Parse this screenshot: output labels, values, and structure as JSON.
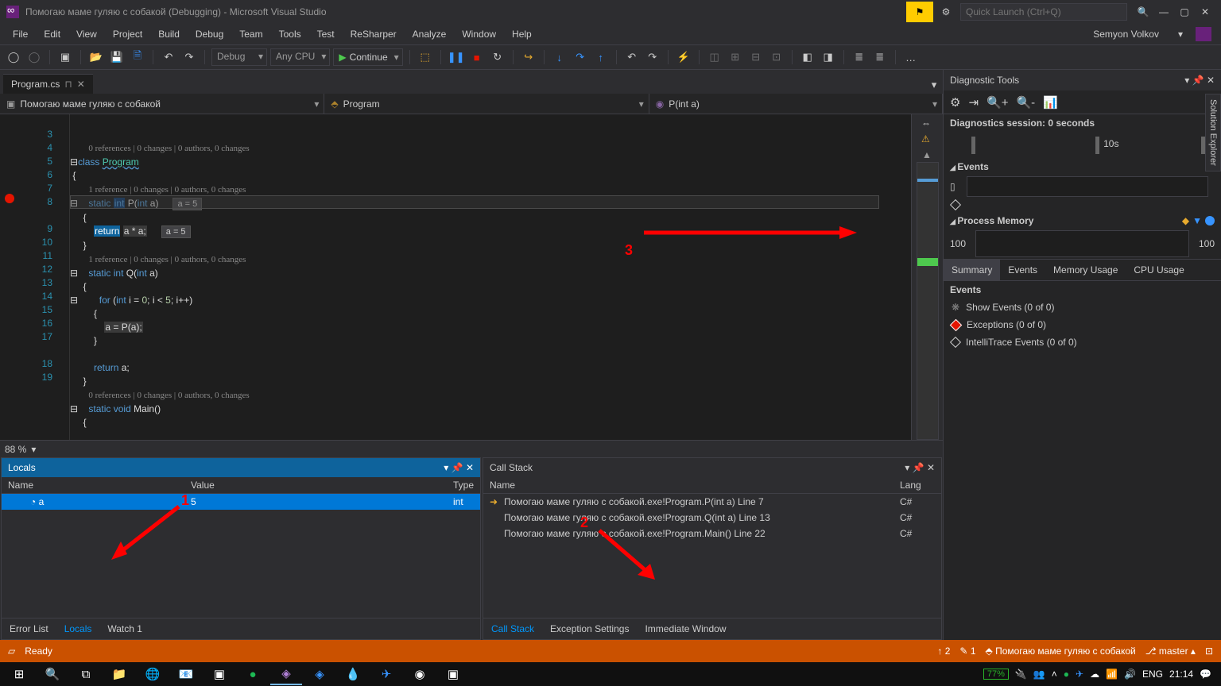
{
  "title": "Помогаю маме гуляю с собакой (Debugging) - Microsoft Visual Studio",
  "quicklaunch_ph": "Quick Launch (Ctrl+Q)",
  "user": "Semyon Volkov",
  "menu": [
    "File",
    "Edit",
    "View",
    "Project",
    "Build",
    "Debug",
    "Team",
    "Tools",
    "Test",
    "ReSharper",
    "Analyze",
    "Window",
    "Help"
  ],
  "config": "Debug",
  "platform": "Any CPU",
  "continue": "Continue",
  "tab": "Program.cs",
  "nav1": "Помогаю маме гуляю с собакой",
  "nav2": "Program",
  "nav3": "P(int a)",
  "zoom": "88 %",
  "cl0": "0 references | 0 changes | 0 authors, 0 changes",
  "cl1": "1 reference | 0 changes | 0 authors, 0 changes",
  "tip1": "a = 5",
  "tip2": "a = 5",
  "diag": {
    "title": "Diagnostic Tools",
    "session": "Diagnostics session: 0 seconds",
    "t10": "10s",
    "events": "Events",
    "procmem": "Process Memory",
    "m1": "100",
    "m2": "100",
    "tabs": [
      "Summary",
      "Events",
      "Memory Usage",
      "CPU Usage"
    ],
    "evhead": "Events",
    "e1": "Show Events (0 of 0)",
    "e2": "Exceptions (0 of 0)",
    "e3": "IntelliTrace Events (0 of 0)"
  },
  "locals": {
    "title": "Locals",
    "cols": [
      "Name",
      "Value",
      "Type"
    ],
    "row": {
      "name": "a",
      "value": "5",
      "type": "int"
    },
    "tabs": [
      "Error List",
      "Locals",
      "Watch 1"
    ]
  },
  "callstack": {
    "title": "Call Stack",
    "cols": [
      "Name",
      "Lang"
    ],
    "rows": [
      {
        "name": "Помогаю маме гуляю с собакой.exe!Program.P(int a) Line 7",
        "lang": "C#"
      },
      {
        "name": "Помогаю маме гуляю с собакой.exe!Program.Q(int a) Line 13",
        "lang": "C#"
      },
      {
        "name": "Помогаю маме гуляю с собакой.exe!Program.Main() Line 22",
        "lang": "C#"
      }
    ],
    "tabs": [
      "Call Stack",
      "Exception Settings",
      "Immediate Window"
    ]
  },
  "status": {
    "ready": "Ready",
    "up": "2",
    "pen": "1",
    "proj": "Помогаю маме гуляю с собакой",
    "branch": "master"
  },
  "taskbar": {
    "battery": "77%",
    "lang": "ENG",
    "time": "21:14"
  },
  "sidepanel": "Solution Explorer",
  "annotations": {
    "a1": "1",
    "a2": "2",
    "a3": "3"
  }
}
